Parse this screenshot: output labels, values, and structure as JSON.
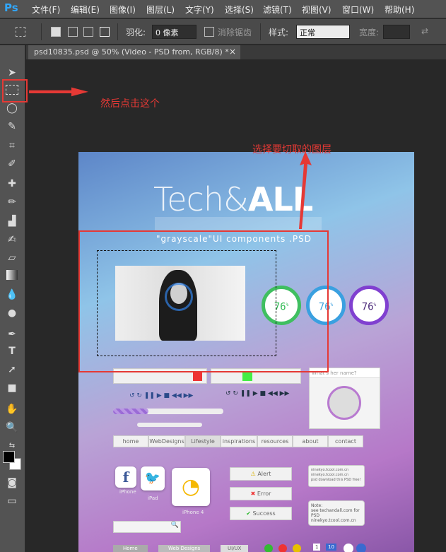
{
  "app": {
    "logo": "Ps"
  },
  "menubar": {
    "items": [
      "文件(F)",
      "编辑(E)",
      "图像(I)",
      "图层(L)",
      "文字(Y)",
      "选择(S)",
      "滤镜(T)",
      "视图(V)",
      "窗口(W)",
      "帮助(H)"
    ]
  },
  "options": {
    "feather_label": "羽化:",
    "feather_value": "0 像素",
    "antialias_label": "消除锯齿",
    "style_label": "样式:",
    "style_value": "正常",
    "width_label": "宽度:"
  },
  "document_tab": {
    "title": "psd10835.psd @ 50% (Video - PSD from, RGB/8) *",
    "close": "×"
  },
  "annotations": {
    "step1": "然后点击这个",
    "step2": "选择要切取的图层"
  },
  "artboard": {
    "title_left": "Tech&",
    "title_right": "ALL",
    "subtitle": "\"grayscale\"UI components .PSD",
    "rings": [
      "76",
      "76",
      "76"
    ],
    "ring_unit": "%",
    "ring_colors": [
      "#3fbf60",
      "#3aa0e0",
      "#8040d0"
    ],
    "search_placeholder": "What's her name?",
    "nav": [
      "home",
      "WebDesigns",
      "Lifestyle",
      "inspirations",
      "resources",
      "about",
      "contact"
    ],
    "app_labels": [
      "iPhone",
      "iPad",
      "iPhone 4"
    ],
    "alerts": [
      "Alert",
      "Error",
      "Success"
    ],
    "tooltip_lines": [
      "ninekyo.tcool.com.cn",
      "ninekyo.tcool.com.cn",
      "psd download this PSD free!"
    ],
    "note": {
      "title": "Note:",
      "lines": [
        "see techandall.com for PSD",
        "ninekyo.tcool.com.cn"
      ]
    },
    "breadcrumb": [
      "Home",
      "Web Designs",
      "UI/UX"
    ],
    "badges": [
      "1",
      "10"
    ]
  }
}
